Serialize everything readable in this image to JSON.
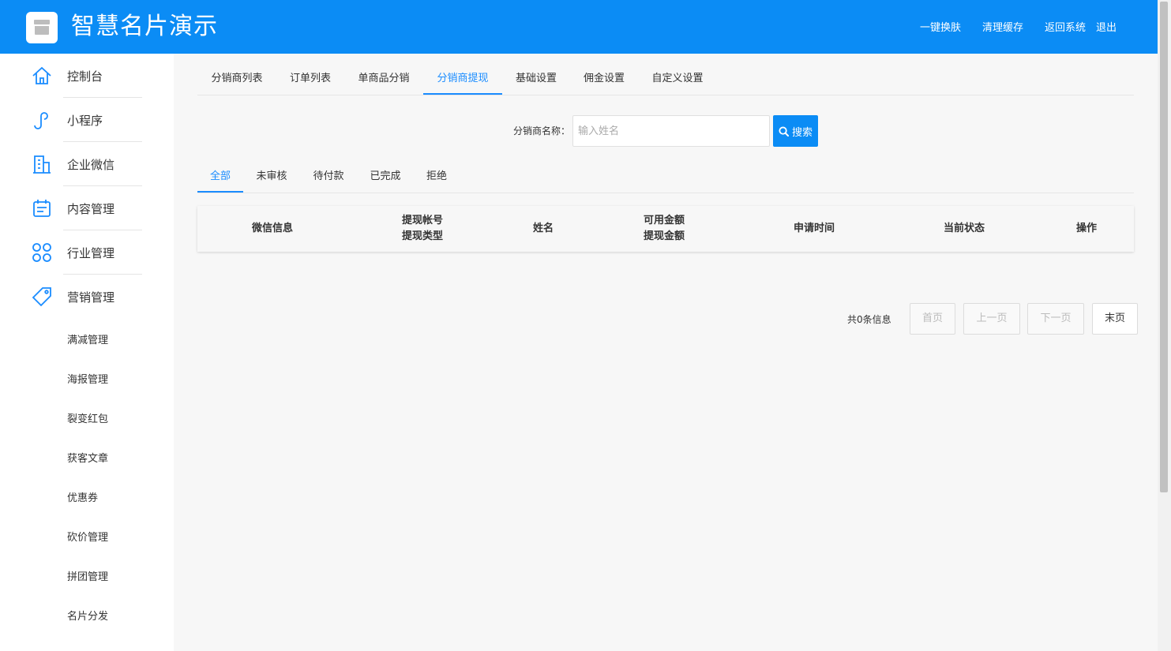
{
  "header": {
    "app_title": "智慧名片演示",
    "links": [
      "一键换肤",
      "清理缓存",
      "返回系统",
      "退出"
    ]
  },
  "sidebar": {
    "items": [
      {
        "label": "控制台",
        "icon": "home-icon"
      },
      {
        "label": "小程序",
        "icon": "link-icon"
      },
      {
        "label": "企业微信",
        "icon": "building-icon"
      },
      {
        "label": "内容管理",
        "icon": "calendar-icon"
      },
      {
        "label": "行业管理",
        "icon": "grid-icon"
      },
      {
        "label": "营销管理",
        "icon": "tag-icon"
      }
    ],
    "sub_items": [
      "满减管理",
      "海报管理",
      "裂变红包",
      "获客文章",
      "优惠券",
      "砍价管理",
      "拼团管理",
      "名片分发"
    ]
  },
  "tabs": [
    "分销商列表",
    "订单列表",
    "单商品分销",
    "分销商提现",
    "基础设置",
    "佣金设置",
    "自定义设置"
  ],
  "active_tab": "分销商提现",
  "search": {
    "label": "分销商名称：",
    "placeholder": "输入姓名",
    "button": "搜索"
  },
  "status_tabs": [
    "全部",
    "未审核",
    "待付款",
    "已完成",
    "拒绝"
  ],
  "table": {
    "columns": [
      [
        "微信信息"
      ],
      [
        "提现帐号",
        "提现类型"
      ],
      [
        "姓名"
      ],
      [
        "可用金额",
        "提现金额"
      ],
      [
        "申请时间"
      ],
      [
        "当前状态"
      ],
      [
        "操作"
      ]
    ]
  },
  "pager": {
    "info": "共0条信息",
    "first": "首页",
    "prev": "上一页",
    "next": "下一页",
    "last": "末页"
  },
  "colors": {
    "brand": "#0b8cf5",
    "active": "#1a8cff"
  }
}
